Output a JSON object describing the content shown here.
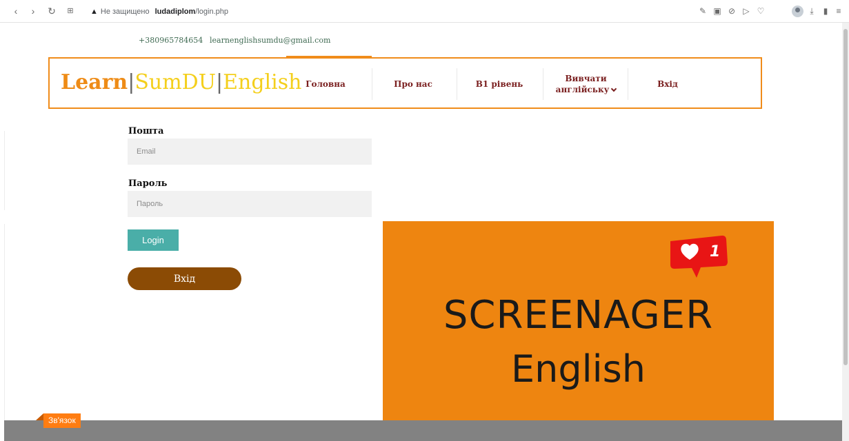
{
  "browser": {
    "warning_text": "Не защищено",
    "host": "ludadiplom",
    "path": "/login.php"
  },
  "contact": {
    "phone": "+380965784654",
    "email": "learnenglishsumdu@gmail.com"
  },
  "logo": {
    "part1": "Learn",
    "sep": "|",
    "part2": "SumDU",
    "part3": "English"
  },
  "menu": {
    "home": "Головна",
    "about": "Про нас",
    "b1": "B1 рівень",
    "learn_line1": "Вивчати",
    "learn_line2": "англійську",
    "login": "Вхід"
  },
  "form": {
    "email_label": "Пошта",
    "email_placeholder": "Email",
    "password_label": "Пароль",
    "password_placeholder": "Пароль",
    "login_button": "Login",
    "enter_button": "Вхід"
  },
  "banner": {
    "line1": "SCREENAGER",
    "line2": "English",
    "like_count": "1"
  },
  "footer": {
    "tab": "Зв'язок"
  },
  "colors": {
    "accent": "#f08c1a",
    "teal": "#4aaea8",
    "brown": "#8b4b05",
    "logo_yellow": "#f4cf1c"
  }
}
